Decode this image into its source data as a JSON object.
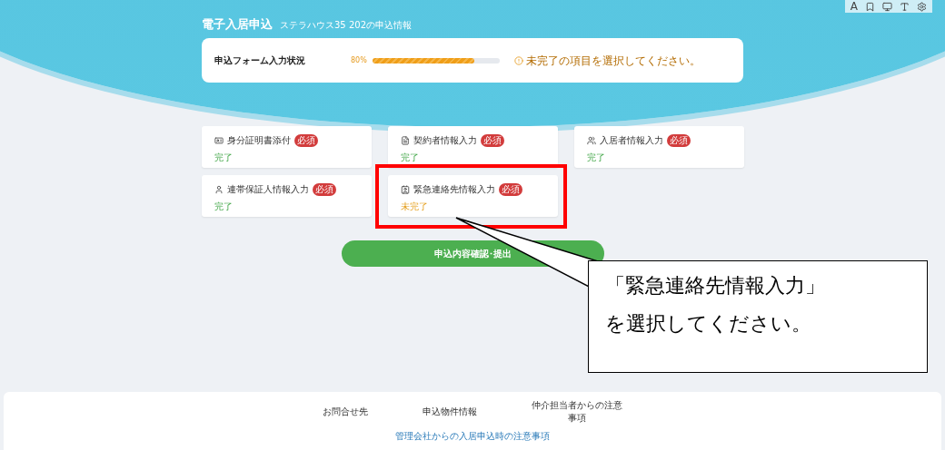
{
  "toolbar": {
    "font_label": "A"
  },
  "header": {
    "title": "電子入居申込",
    "subtitle": "ステラハウス35 202の申込情報"
  },
  "progress": {
    "label": "申込フォーム入力状況",
    "percent": "80%",
    "level": 0.8,
    "hint": "未完了の項目を選択してください。"
  },
  "sections": [
    {
      "kind": "id-card",
      "label": "身分証明書添付",
      "badge": "必須",
      "status": "完了",
      "complete": true
    },
    {
      "kind": "document",
      "label": "契約者情報入力",
      "badge": "必須",
      "status": "完了",
      "complete": true
    },
    {
      "kind": "users",
      "label": "入居者情報入力",
      "badge": "必須",
      "status": "完了",
      "complete": true
    },
    {
      "kind": "user",
      "label": "連帯保証人情報入力",
      "badge": "必須",
      "status": "完了",
      "complete": true
    },
    {
      "kind": "contact",
      "label": "緊急連絡先情報入力",
      "badge": "必須",
      "status": "未完了",
      "complete": false,
      "highlighted": true
    }
  ],
  "submit_button": "申込内容確認･提出",
  "callout": {
    "lines": [
      "「緊急連絡先情報入力」",
      "を選択してください。"
    ]
  },
  "footer": {
    "links": [
      "お問合せ先",
      "申込物件情報",
      "仲介担当者からの注意事項"
    ],
    "notice_link": "管理会社からの入居申込時の注意事項"
  }
}
